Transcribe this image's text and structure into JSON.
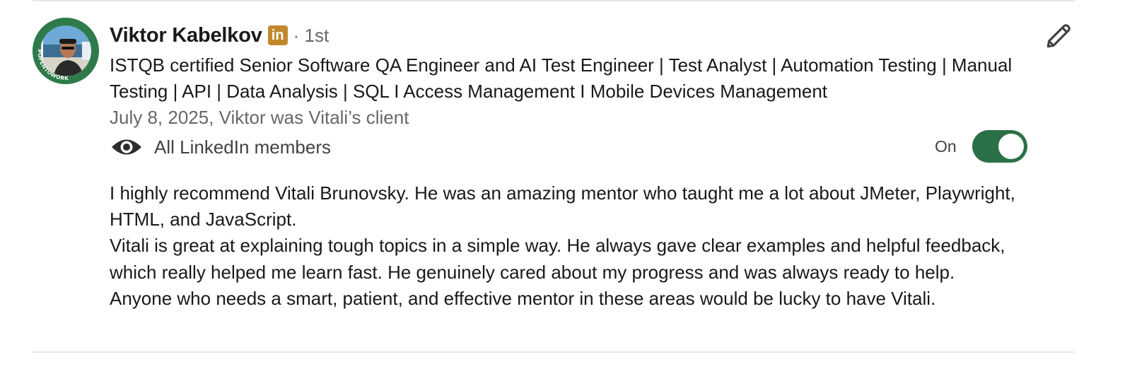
{
  "recommender": {
    "name": "Viktor Kabelkov",
    "linkedin_badge": "in",
    "degree": "· 1st",
    "avatar_badge_text": "#OPENTOWORK",
    "headline": "ISTQB certified Senior Software QA Engineer and AI Test Engineer | Test Analyst | Automation Testing | Manual Testing | API | Data Analysis | SQL I Access Management I Mobile Devices Management",
    "relationship": "July 8, 2025, Viktor was Vitali’s client"
  },
  "visibility": {
    "icon": "eye-icon",
    "label": "All LinkedIn members"
  },
  "toggle": {
    "label": "On",
    "state": "on",
    "color": "#2b7148"
  },
  "edit": {
    "icon": "pencil-icon"
  },
  "recommendation": {
    "paragraphs": [
      "I highly recommend Vitali Brunovsky. He was an amazing mentor who taught me a lot about JMeter, Playwright, HTML, and JavaScript.",
      "Vitali is great at explaining tough topics in a simple way. He always gave clear examples and helpful feedback, which really helped me learn fast. He genuinely cared about my progress and was always ready to help.",
      "Anyone who needs a smart, patient, and effective mentor in these areas would be lucky to have Vitali."
    ]
  },
  "colors": {
    "linkedin_badge": "#c1882c",
    "open_to_work_ring": "#2f7a4a"
  }
}
